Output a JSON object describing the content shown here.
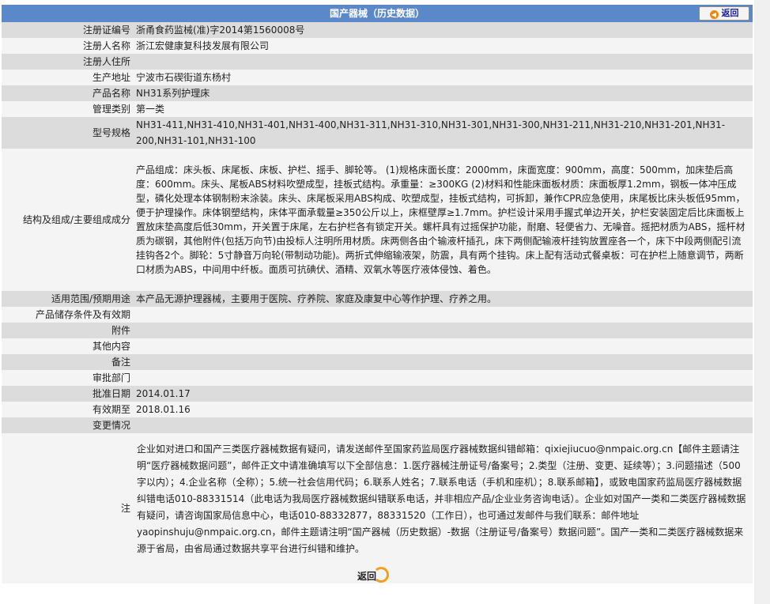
{
  "title": "国产器械（历史数据）",
  "back_label": "返回",
  "rows": [
    {
      "label": "注册证编号",
      "value": "浙甬食药监械(准)字2014第1560008号"
    },
    {
      "label": "注册人名称",
      "value": "浙江宏健康复科技发展有限公司"
    },
    {
      "label": "注册人住所",
      "value": ""
    },
    {
      "label": "生产地址",
      "value": "宁波市石碶街道东杨村"
    },
    {
      "label": "产品名称",
      "value": "NH31系列护理床"
    },
    {
      "label": "管理类别",
      "value": "第一类"
    },
    {
      "label": "型号规格",
      "value": "NH31-411,NH31-410,NH31-401,NH31-400,NH31-311,NH31-310,NH31-301,NH31-300,NH31-211,NH31-210,NH31-201,NH31-200,NH31-101,NH31-100"
    },
    {
      "label": "结构及组成/主要组成成分",
      "value": "产品组成：床头板、床尾板、床板、护栏、摇手、脚轮等。 (1)规格床面长度：2000mm，床面宽度：900mm，高度：500mm，加床垫后高度：600mm。床头、尾板ABS材料吹塑成型，挂板式结构。承重量：≥300KG (2)材料和性能床面板材质：床面板厚1.2mm，钢板一体冲压成型，磷化处理本体钢制粉末涂装。床头、床尾板采用ABS构成、吹塑成型，挂板式结构，可拆卸，兼作CPR应急使用，床尾板比床头板低95mm，便于护理操作。床体钢塑结构，床体平面承载量≥350公斤以上，床框壁厚≥1.7mm。护栏设计采用手握式单边开关，护栏安装固定后比床面板上置放床垫高度后低30mm，开关置于床尾，左右护栏各有锁定开关。螺杆具有过摇保护功能，耐磨、轻便省力、无噪音。摇把材质为ABS，摇杆材质为碳钢，其他附件(包括万向节)由投标人注明所用材质。床两侧各由个输液杆插孔，床下两侧配输液杆挂钩放置座各一个，床下中段两侧配引流挂钩各2个。脚轮：5寸静音万向轮(带制动功能)。两折式伸缩输液架，防震，具有两个挂钩。床上配有活动式餐桌板：可在护栏上随意调节，两断口材质为ABS，中间用中纤板。面质可抗碘伏、酒精、双氧水等医疗液体侵蚀、着色。"
    },
    {
      "label": "适用范围/预期用途",
      "value": "本产品无源护理器械，主要用于医院、疗养院、家庭及康复中心等作护理、疗养之用。"
    },
    {
      "label": "产品储存条件及有效期",
      "value": ""
    },
    {
      "label": "附件",
      "value": ""
    },
    {
      "label": "其他内容",
      "value": ""
    },
    {
      "label": "备注",
      "value": ""
    },
    {
      "label": "审批部门",
      "value": ""
    },
    {
      "label": "批准日期",
      "value": "2014.01.17"
    },
    {
      "label": "有效期至",
      "value": "2018.01.16"
    },
    {
      "label": "变更情况",
      "value": ""
    },
    {
      "label": "注",
      "value": "企业如对进口和国产三类医疗器械数据有疑问，请发送邮件至国家药监局医疗器械数据纠错邮箱：qixiejiucuo@nmpaic.org.cn【邮件主题请注明“医疗器械数据问题”，邮件正文中请准确填写以下全部信息：1.医疗器械注册证号/备案号；2.类型（注册、变更、延续等）；3.问题描述（500字以内）；4.企业名称（全称）；5.统一社会信用代码；6.联系人姓名；7.联系电话（手机和座机）；8.联系邮箱】，或致电国家药监局医疗器械数据纠错电话010-88331514（此电话为我局医疗器械数据纠错联系电话，并非相应产品/企业业务咨询电话）。企业如对国产一类和二类医疗器械数据有疑问，请咨询国家局信息中心，电话010-88332877，88331520（工作日），也可通过发邮件与我们联系：邮件地址yaopinshuju@nmpaic.org.cn，邮件主题请注明“国产器械（历史数据）-数据（注册证号/备案号）数据问题”。国产一类和二类医疗器械数据来源于省局，由省局通过数据共享平台进行纠错和维护。"
    }
  ]
}
